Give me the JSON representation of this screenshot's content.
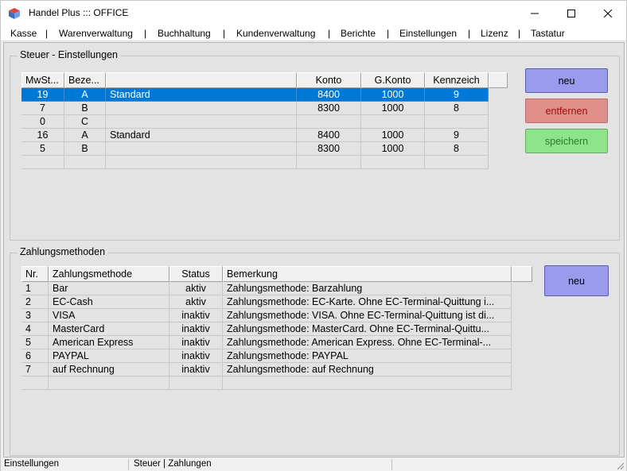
{
  "window": {
    "title": "Handel Plus ::: OFFICE"
  },
  "menu": [
    "Kasse",
    "Warenverwaltung",
    "Buchhaltung",
    "Kundenverwaltung",
    "Berichte",
    "Einstellungen",
    "Lizenz",
    "Tastatur"
  ],
  "menu_separator": "|",
  "steuer": {
    "title": "Steuer - Einstellungen",
    "columns": [
      "MwSt...",
      "Beze...",
      "",
      "Konto",
      "G.Konto",
      "Kennzeich"
    ],
    "rows": [
      [
        "19",
        "A",
        "Standard",
        "8400",
        "1000",
        "9"
      ],
      [
        "7",
        "B",
        "",
        "8300",
        "1000",
        "8"
      ],
      [
        "0",
        "C",
        "",
        "",
        "",
        ""
      ],
      [
        "16",
        "A",
        "Standard",
        "8400",
        "1000",
        "9"
      ],
      [
        "5",
        "B",
        "",
        "8300",
        "1000",
        "8"
      ]
    ],
    "selected_row": 0,
    "buttons": {
      "new": "neu",
      "remove": "entfernen",
      "save": "speichern"
    }
  },
  "zahlung": {
    "title": "Zahlungsmethoden",
    "columns": [
      "Nr.",
      "Zahlungsmethode",
      "Status",
      "Bemerkung"
    ],
    "rows": [
      [
        "1",
        "Bar",
        "aktiv",
        "Zahlungsmethode: Barzahlung"
      ],
      [
        "2",
        "EC-Cash",
        "aktiv",
        "Zahlungsmethode: EC-Karte. Ohne EC-Terminal-Quittung i..."
      ],
      [
        "3",
        "VISA",
        "inaktiv",
        "Zahlungsmethode: VISA. Ohne EC-Terminal-Quittung ist di..."
      ],
      [
        "4",
        "MasterCard",
        "inaktiv",
        "Zahlungsmethode: MasterCard. Ohne EC-Terminal-Quittu..."
      ],
      [
        "5",
        "American Express",
        "inaktiv",
        "Zahlungsmethode: American Express. Ohne EC-Terminal-..."
      ],
      [
        "6",
        "PAYPAL",
        "inaktiv",
        "Zahlungsmethode: PAYPAL"
      ],
      [
        "7",
        "auf Rechnung",
        "inaktiv",
        "Zahlungsmethode: auf Rechnung"
      ]
    ],
    "buttons": {
      "new": "neu"
    }
  },
  "status": {
    "left": "Einstellungen",
    "right": "Steuer | Zahlungen"
  },
  "colors": {
    "selection": "#0078d7",
    "btn_blue": "#9b9bed",
    "btn_red": "#e08b86",
    "btn_green": "#8ee48a"
  }
}
